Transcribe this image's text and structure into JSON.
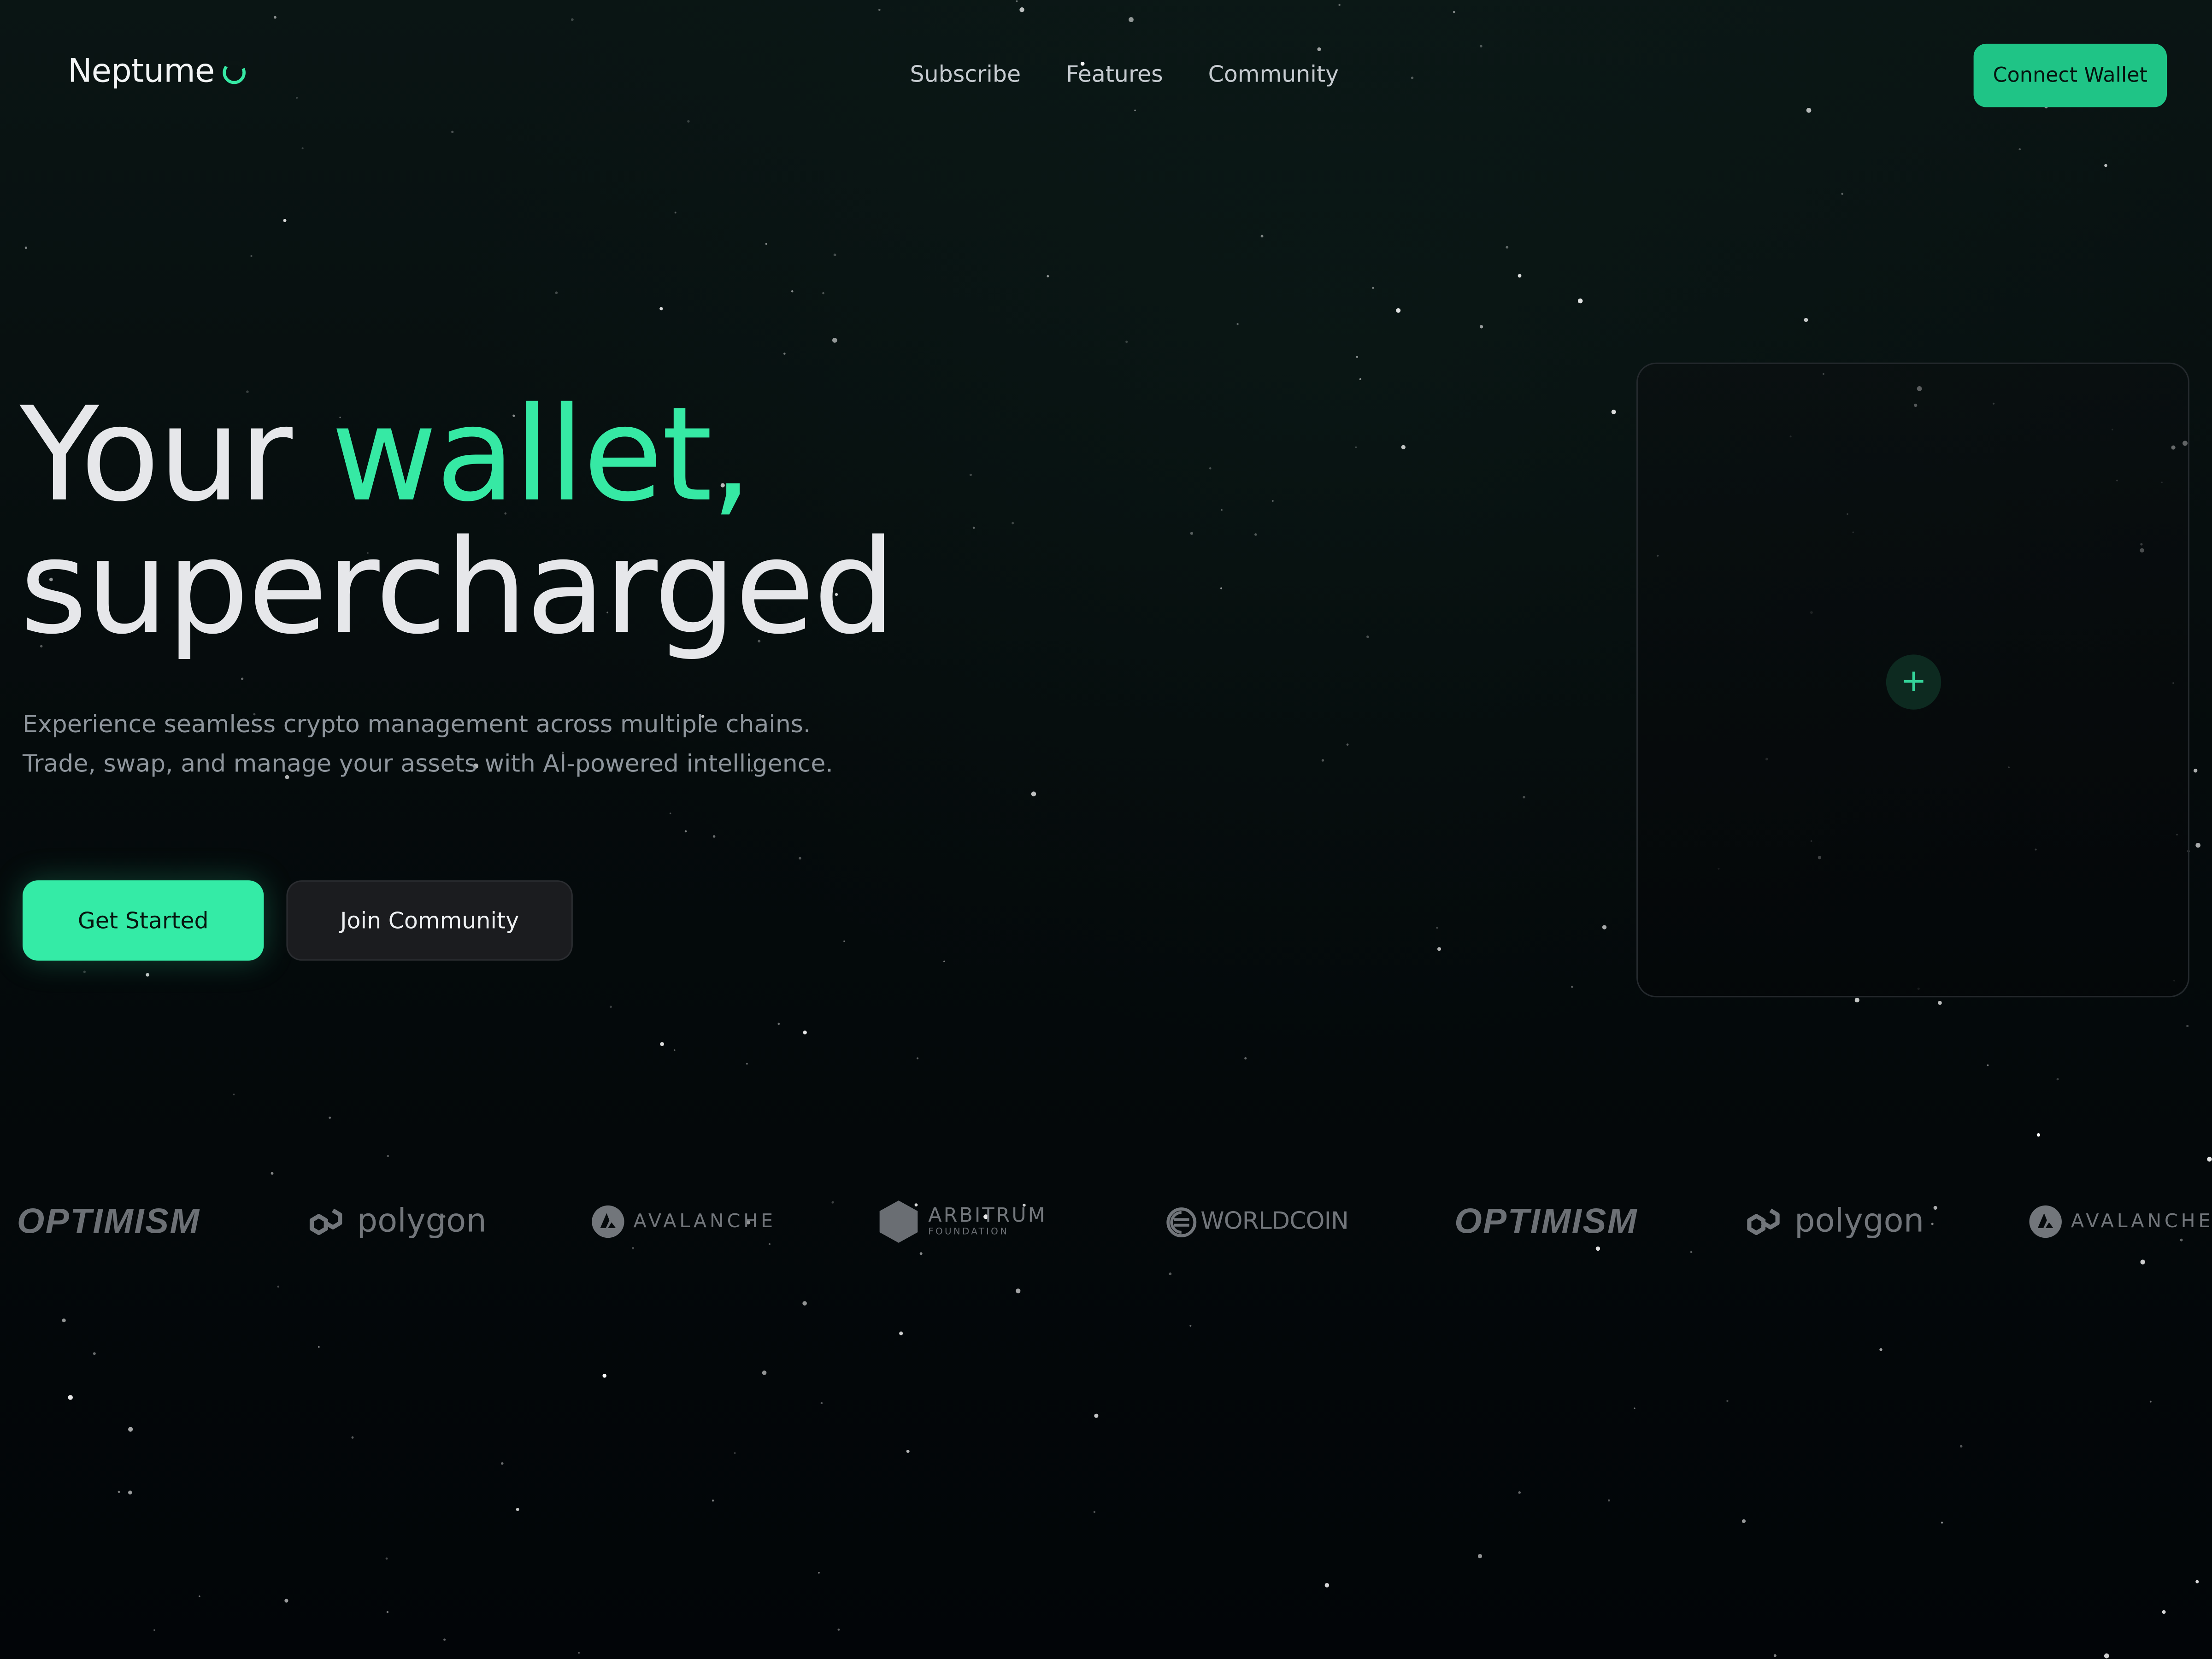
{
  "brand": {
    "name": "Neptume",
    "icon": "crescent-ring-icon",
    "accent_color": "#36e9a4"
  },
  "nav": {
    "items": [
      {
        "label": "Subscribe"
      },
      {
        "label": "Features"
      },
      {
        "label": "Community"
      }
    ],
    "connect_label": "Connect Wallet"
  },
  "hero": {
    "title_word1": "Your",
    "title_accent": "wallet,",
    "title_line2": "supercharged",
    "subtitle": "Experience seamless crypto management across multiple chains. Trade, swap, and manage your assets with AI-powered intelligence.",
    "primary_cta": "Get Started",
    "secondary_cta": "Join Community"
  },
  "card": {
    "add_icon": "plus-icon",
    "add_symbol": "+"
  },
  "partners": [
    {
      "id": "optimism",
      "label": "OPTIMISM",
      "icon": "optimism-wordmark"
    },
    {
      "id": "polygon",
      "label": "polygon",
      "icon": "polygon-icon"
    },
    {
      "id": "avalanche",
      "label": "AVALANCHE",
      "icon": "avalanche-icon"
    },
    {
      "id": "arbitrum",
      "label": "ARBITRUM",
      "sub": "FOUNDATION",
      "icon": "arbitrum-hex-icon"
    },
    {
      "id": "worldcoin",
      "label": "WORLDCOIN",
      "icon": "worldcoin-icon"
    },
    {
      "id": "optimism-2",
      "label": "OPTIMISM",
      "icon": "optimism-wordmark"
    },
    {
      "id": "polygon-2",
      "label": "polygon",
      "icon": "polygon-icon"
    },
    {
      "id": "avalanche-2",
      "label": "AVALANCHE",
      "icon": "avalanche-icon"
    }
  ]
}
